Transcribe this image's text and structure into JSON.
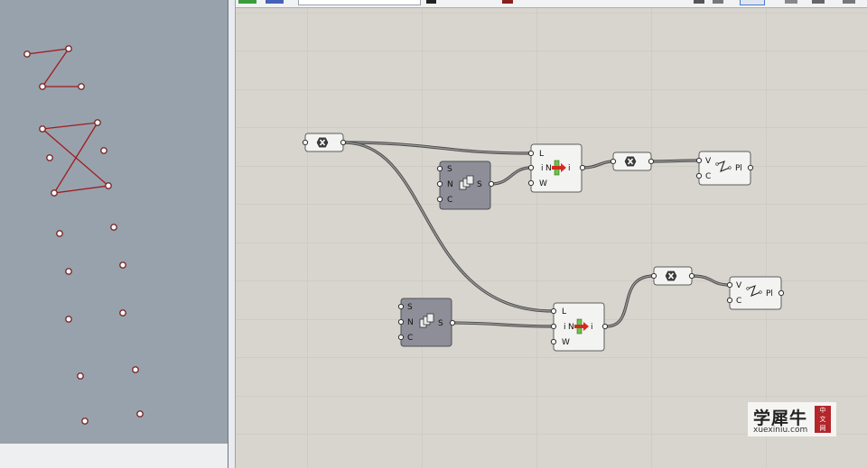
{
  "watermark": {
    "chinese": "学犀牛",
    "badge": [
      "中",
      "文",
      "网"
    ],
    "url": "xuexiniu.com"
  },
  "components": {
    "dispatch1": {
      "inputs": [
        "L",
        "i",
        "W"
      ],
      "center": "N",
      "output": "i"
    },
    "dispatch2": {
      "inputs": [
        "L",
        "i",
        "W"
      ],
      "center": "N",
      "output": "i"
    },
    "series1": {
      "inputs": [
        "S",
        "N",
        "C"
      ],
      "output": "S"
    },
    "series2": {
      "inputs": [
        "S",
        "N",
        "C"
      ],
      "output": "S"
    },
    "polyline1": {
      "inputs": [
        "V",
        "C"
      ],
      "output": "Pl"
    },
    "polyline2": {
      "inputs": [
        "V",
        "C"
      ],
      "output": "Pl"
    }
  },
  "colors": {
    "viewport_bg": "#98a2ad",
    "canvas_bg": "#d8d5ce",
    "curve": "#a01c1c",
    "param_hex": "#3b3b3b"
  }
}
